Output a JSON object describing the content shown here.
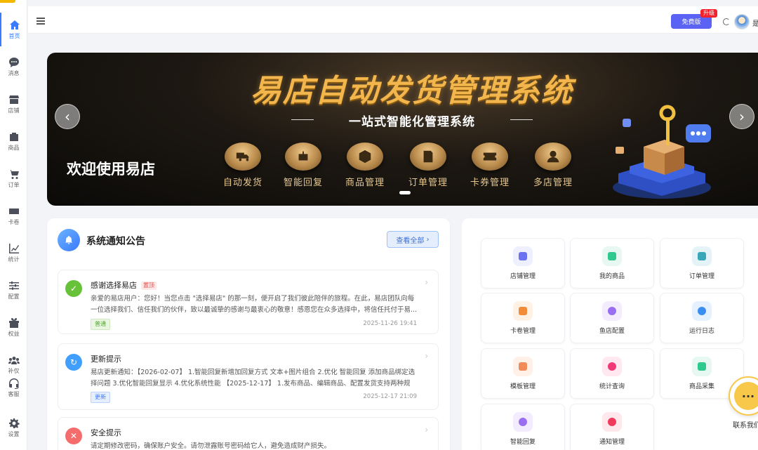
{
  "sidebar": {
    "items": [
      {
        "label": "首页",
        "icon": "home-icon",
        "active": true
      },
      {
        "label": "消息",
        "icon": "message-icon"
      },
      {
        "label": "店铺",
        "icon": "store-icon"
      },
      {
        "label": "商品",
        "icon": "box-icon"
      },
      {
        "label": "订单",
        "icon": "cart-icon"
      },
      {
        "label": "卡卷",
        "icon": "card-icon"
      },
      {
        "label": "统计",
        "icon": "chart-icon"
      },
      {
        "label": "配置",
        "icon": "sliders-icon"
      },
      {
        "label": "权益",
        "icon": "gift-icon"
      },
      {
        "label": "补仅",
        "icon": "team-icon"
      },
      {
        "label": "客服",
        "icon": "headset-icon"
      },
      {
        "label": "设置",
        "icon": "gear-icon"
      }
    ]
  },
  "header": {
    "plan_label": "免费版",
    "upgrade_badge": "升级",
    "user_name": "是"
  },
  "banner": {
    "title": "易店自动发货管理系统",
    "subtitle": "一站式智能化管理系统",
    "welcome": "欢迎使用易店",
    "features": [
      "自动发货",
      "智能回复",
      "商品管理",
      "订单管理",
      "卡券管理",
      "多店管理"
    ],
    "prev_icon": "chevron-left-icon",
    "next_icon": "chevron-right-icon"
  },
  "notices": {
    "title": "系统通知公告",
    "view_all": "查看全部",
    "items": [
      {
        "title": "感谢选择易店",
        "pin": "置顶",
        "body": "亲爱的易店用户：您好！当您点击 \"选择易店\" 的那一刻，便开启了我们彼此陪伴的旅程。在此，易店团队向每一位选择我们、信任我们的伙伴，致以最诚挚的感谢与最衷心的敬意！感恩您在众多选择中，将信任托付于易...",
        "tag": "普通",
        "time": "2025-11-26 19:41",
        "icon": "check-icon",
        "color": "#67c23a"
      },
      {
        "title": "更新提示",
        "body": "易店更新通知：【2026-02-07】 1.智能回复新增加回复方式 文本+图片组合 2.优化 智能回复 添加商品绑定选择问题 3.优化智能回复显示 4.优化系统性能 【2025-12-17】 1.发布商品、编辑商品、配置发货支持两种规格...",
        "tag": "更新",
        "time": "2025-12-17 21:09",
        "icon": "refresh-icon",
        "color": "#409eff"
      },
      {
        "title": "安全提示",
        "body": "请定期修改密码，确保账户安全。请勿泄露账号密码给它人，避免造成财产损失。",
        "icon": "close-icon",
        "color": "#f56c6c"
      }
    ]
  },
  "quick": {
    "items": [
      {
        "label": "店铺管理",
        "color": "#6b72f0",
        "bg": "#eef0ff"
      },
      {
        "label": "我的商品",
        "color": "#2fc98d",
        "bg": "#e6f8f1"
      },
      {
        "label": "订单管理",
        "color": "#3aa7b8",
        "bg": "#e4f4f6"
      },
      {
        "label": "卡卷管理",
        "color": "#f08c3a",
        "bg": "#fff1e4"
      },
      {
        "label": "鱼店配置",
        "color": "#9a6ef0",
        "bg": "#f3ecff"
      },
      {
        "label": "运行日志",
        "color": "#3a8ef0",
        "bg": "#e6f1ff"
      },
      {
        "label": "模板管理",
        "color": "#f08c5a",
        "bg": "#fff0e8"
      },
      {
        "label": "统计查询",
        "color": "#f03a78",
        "bg": "#ffe8f0"
      },
      {
        "label": "商品采集",
        "color": "#2fc98d",
        "bg": "#e6f8f1"
      },
      {
        "label": "智能回复",
        "color": "#9a6ef0",
        "bg": "#f3ecff"
      },
      {
        "label": "通知管理",
        "color": "#f03a5a",
        "bg": "#ffe8ec"
      }
    ]
  },
  "support": {
    "label": "联系我们"
  }
}
